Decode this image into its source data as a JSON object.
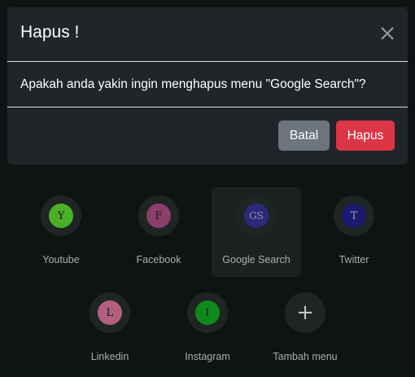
{
  "modal": {
    "title": "Hapus !",
    "message": "Apakah anda yakin ingin menghapus menu \"Google Search\"?",
    "cancel_label": "Batal",
    "delete_label": "Hapus"
  },
  "shortcuts": [
    {
      "name": "Youtube",
      "initial": "Y",
      "color": "#4caf2a"
    },
    {
      "name": "Facebook",
      "initial": "F",
      "color": "#8b3f6a"
    },
    {
      "name": "Google Search",
      "initial": "GS",
      "color": "#2a2a7a",
      "selected": true
    },
    {
      "name": "Twitter",
      "initial": "T",
      "color": "#1a1a6e"
    },
    {
      "name": "Linkedin",
      "initial": "L",
      "color": "#b25f80"
    },
    {
      "name": "Instagram",
      "initial": "I",
      "color": "#0f8a1a"
    }
  ],
  "add_menu": {
    "label": "Tambah menu",
    "icon": "plus-icon"
  },
  "colors": {
    "modal_bg": "#212529",
    "cancel": "#6c757d",
    "danger": "#dc3545",
    "page_bg": "#0e1412"
  }
}
